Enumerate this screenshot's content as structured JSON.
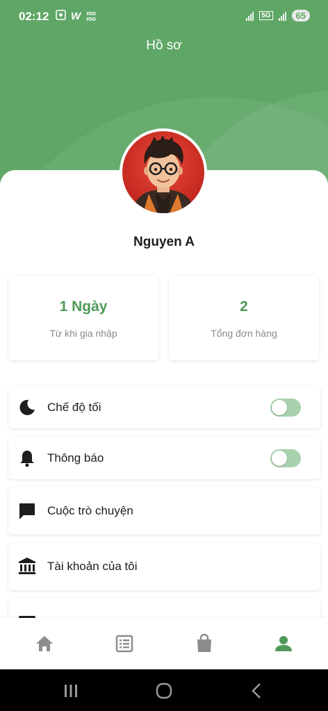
{
  "status_bar": {
    "time": "02:12",
    "left_icons": [
      "screen-record-icon",
      "w-app-icon",
      "momo-icon"
    ],
    "left_text": [
      "W",
      "mo mo"
    ],
    "network": "5G",
    "battery": "65"
  },
  "header": {
    "title": "Hồ sơ"
  },
  "profile": {
    "name": "Nguyen A",
    "avatar": "cartoon-avatar-glasses"
  },
  "stats": [
    {
      "value": "1 Ngày",
      "label": "Từ khi gia nhập"
    },
    {
      "value": "2",
      "label": "Tổng đơn hàng"
    }
  ],
  "menu": [
    {
      "label": "Chế độ tối",
      "icon": "moon-icon",
      "toggle": true,
      "on": false
    },
    {
      "label": "Thông báo",
      "icon": "bell-icon",
      "toggle": true,
      "on": false
    },
    {
      "label": "Cuộc trò chuyện",
      "icon": "chat-icon",
      "toggle": false
    },
    {
      "label": "Tài khoản của tôi",
      "icon": "bank-icon",
      "toggle": false
    },
    {
      "label": "",
      "icon": "wallet-icon",
      "toggle": false
    }
  ],
  "bottom_nav": [
    {
      "name": "home-icon",
      "active": false
    },
    {
      "name": "orders-list-icon",
      "active": false
    },
    {
      "name": "shopping-bag-icon",
      "active": false
    },
    {
      "name": "profile-person-icon",
      "active": true
    }
  ],
  "colors": {
    "primary": "#5fa767",
    "accent_text": "#4f9a58",
    "toggle_track": "#a8d2ad",
    "inactive_icon": "#8c8c8c"
  }
}
